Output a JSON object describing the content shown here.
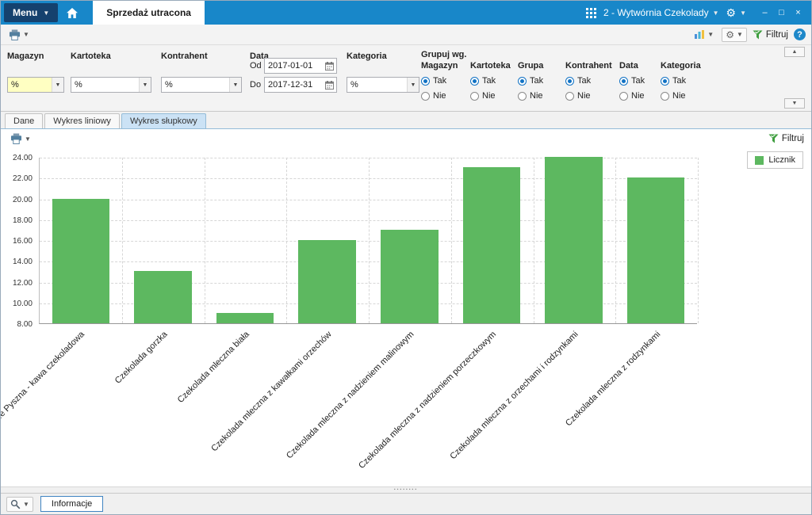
{
  "titlebar": {
    "menu_label": "Menu",
    "page_tab": "Sprzedaż utracona",
    "company_selector": "2 - Wytwórnia Czekolady",
    "minimize": "–",
    "maximize": "□",
    "close": "×"
  },
  "filter_toolbar": {
    "filtruj_label": "Filtruj",
    "help_label": "?"
  },
  "filter_panel": {
    "magazyn_label": "Magazyn",
    "magazyn_value": "%",
    "kartoteka_label": "Kartoteka",
    "kartoteka_value": "%",
    "kontrahent_label": "Kontrahent",
    "kontrahent_value": "%",
    "data_label": "Data",
    "od_label": "Od",
    "od_value": "2017-01-01",
    "do_label": "Do",
    "do_value": "2017-12-31",
    "kategoria_label": "Kategoria",
    "kategoria_value": "%",
    "grupuj_label": "Grupuj wg.",
    "radio_yes_label": "Tak",
    "radio_no_label": "Nie",
    "groups": [
      {
        "label": "Magazyn",
        "selected": "Tak"
      },
      {
        "label": "Kartoteka",
        "selected": "Tak"
      },
      {
        "label": "Grupa",
        "selected": "Tak"
      },
      {
        "label": "Kontrahent",
        "selected": "Tak"
      },
      {
        "label": "Data",
        "selected": "Tak"
      },
      {
        "label": "Kategoria",
        "selected": "Tak"
      }
    ]
  },
  "view_tabs": [
    {
      "label": "Dane",
      "active": false
    },
    {
      "label": "Wykres liniowy",
      "active": false
    },
    {
      "label": "Wykres słupkowy",
      "active": true
    }
  ],
  "chart_toolbar": {
    "filtruj_label": "Filtruj"
  },
  "chart_data": {
    "type": "bar",
    "title": "",
    "categories": [
      "Cafe Pyszna - kawa czekoladowa",
      "Czekolada gorzka",
      "Czekolada mleczna biała",
      "Czekolada mleczna z kawałkami orzechów",
      "Czekolada mleczna z nadzieniem malinowym",
      "Czekolada mleczna z nadzieniem porzeczkowym",
      "Czekolada mleczna z orzechami i rodzynkami",
      "Czekolada mleczna z rodzynkami"
    ],
    "values": [
      20,
      13,
      9,
      16,
      17,
      23,
      24,
      22
    ],
    "series_name": "Licznik",
    "ylim": [
      8,
      24
    ],
    "ytick_step": 2,
    "ytick_format_decimals": 2,
    "bar_color": "#5db860",
    "grid": true,
    "legend_position": "top-right"
  },
  "statusbar": {
    "informacje_label": "Informacje"
  },
  "colors": {
    "titlebar_blue": "#1887c9",
    "menu_navy": "#15416e",
    "bar_green": "#5db860",
    "filter_green": "#3f9e3f",
    "help_blue": "#1e88c9",
    "select_yellow": "#ffffc2",
    "radio_blue": "#1273c4"
  }
}
